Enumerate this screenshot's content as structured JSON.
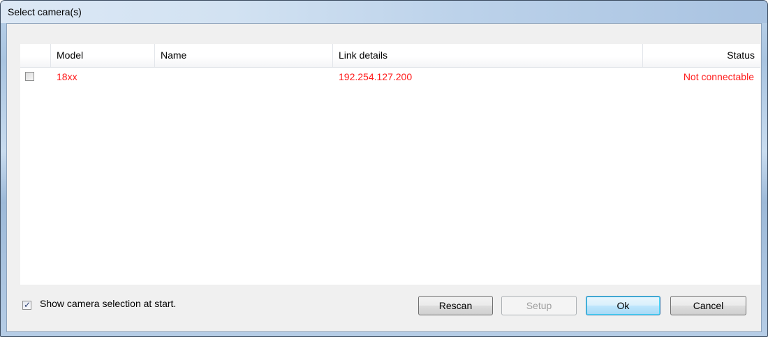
{
  "window": {
    "title": "Select camera(s)"
  },
  "table": {
    "columns": [
      "Model",
      "Name",
      "Link details",
      "Status"
    ],
    "rows": [
      {
        "checked": false,
        "model": "18xx",
        "name": "",
        "link_details": "192.254.127.200",
        "status": "Not connectable"
      }
    ]
  },
  "footer": {
    "show_at_start_label": "Show camera selection at start.",
    "show_at_start_checked": true,
    "buttons": {
      "rescan": "Rescan",
      "setup": "Setup",
      "ok": "Ok",
      "cancel": "Cancel"
    }
  },
  "colors": {
    "row_text_error": "#ff1a1a",
    "default_button_border": "#3c7fb1"
  }
}
